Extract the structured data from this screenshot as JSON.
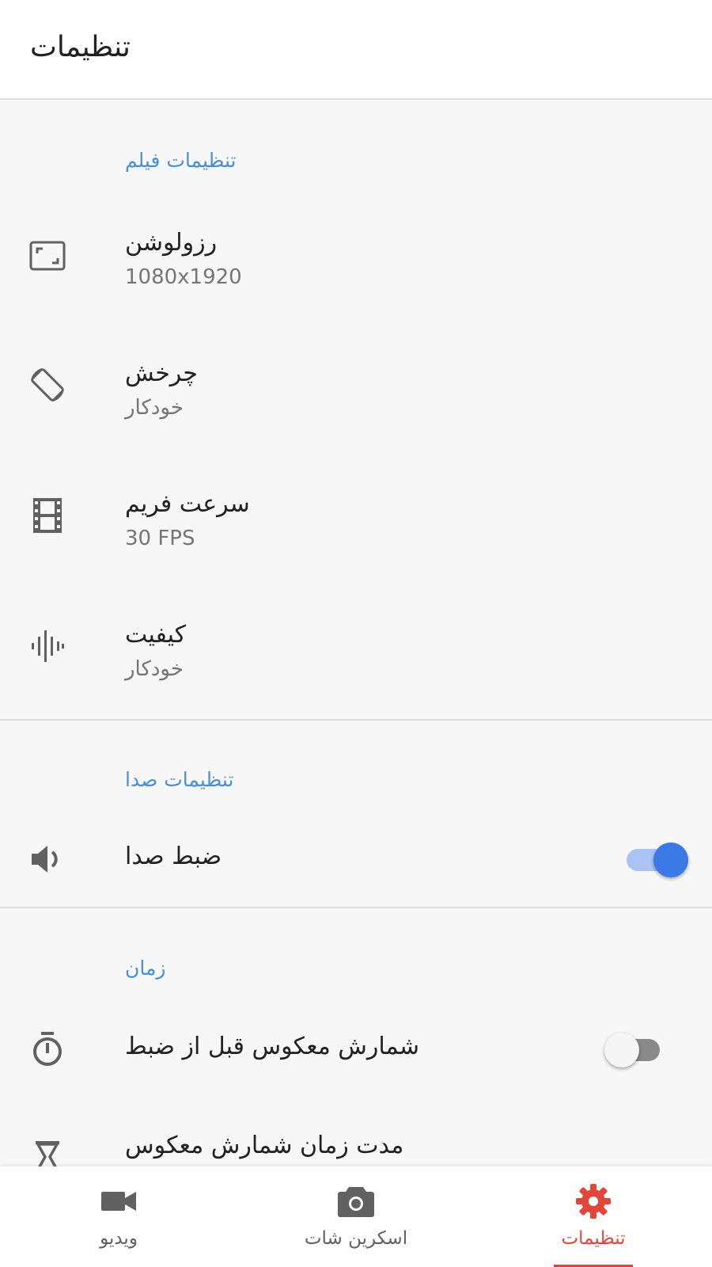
{
  "app_bar": {
    "title": "تنظیمات"
  },
  "colors": {
    "accent_blue": "#4a8fd6",
    "nav_active_red": "#e0463a",
    "switch_on": "#3b7ae6"
  },
  "sections": {
    "video": {
      "header": "تنظیمات فیلم",
      "resolution": {
        "title": "رزولوشن",
        "value": "1080x1920",
        "icon": "aspect-ratio-icon"
      },
      "rotation": {
        "title": "چرخش",
        "value": "خودکار",
        "icon": "screen-rotation-icon"
      },
      "frame_rate": {
        "title": "سرعت فریم",
        "value": "30 FPS",
        "icon": "film-strip-icon"
      },
      "quality": {
        "title": "کیفیت",
        "value": "خودکار",
        "icon": "audio-waveform-icon"
      }
    },
    "audio": {
      "header": "تنظیمات صدا",
      "record_audio": {
        "title": "ضبط صدا",
        "enabled": true,
        "icon": "volume-icon"
      }
    },
    "time": {
      "header": "زمان",
      "countdown": {
        "title": "شمارش معکوس قبل از ضبط",
        "enabled": false,
        "icon": "timer-icon"
      },
      "countdown_duration": {
        "title": "مدت زمان شمارش معکوس",
        "icon": "hourglass-icon"
      }
    }
  },
  "bottom_nav": {
    "items": [
      {
        "label": "ویدیو",
        "icon": "videocam-icon",
        "active": false
      },
      {
        "label": "اسکرین شات",
        "icon": "camera-icon",
        "active": false
      },
      {
        "label": "تنظیمات",
        "icon": "settings-gear-icon",
        "active": true
      }
    ]
  }
}
